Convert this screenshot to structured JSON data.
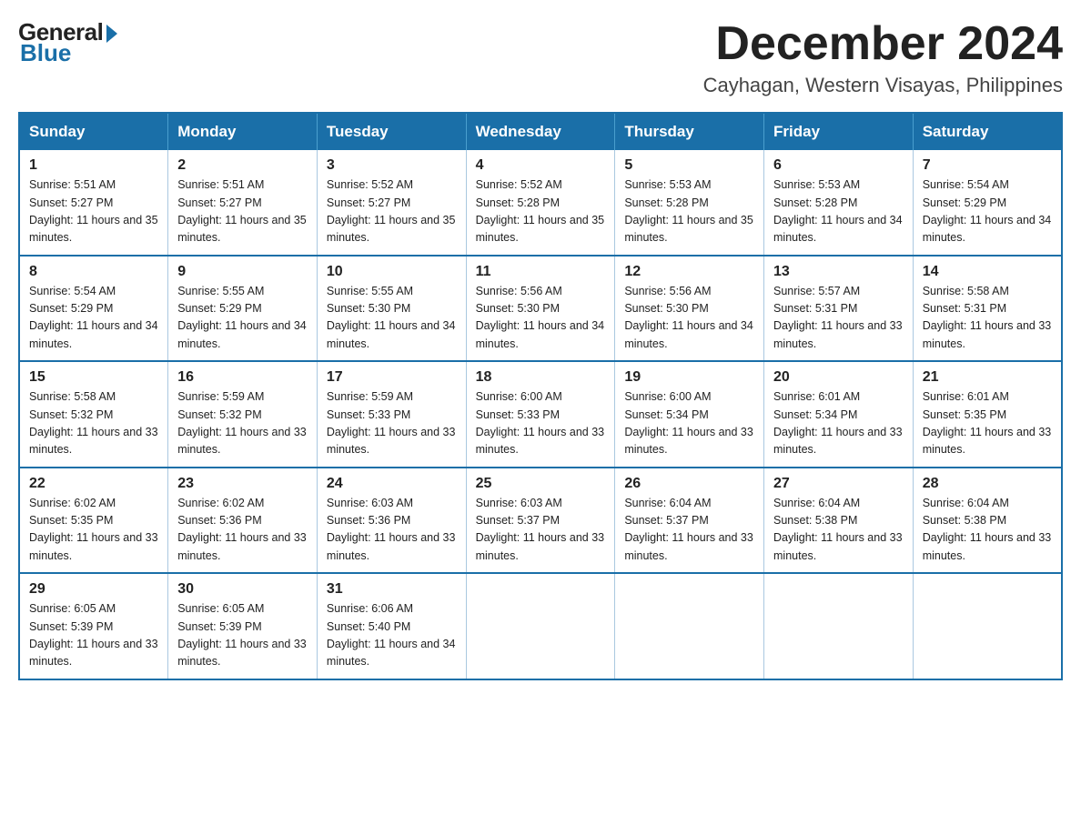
{
  "logo": {
    "general": "General",
    "blue": "Blue"
  },
  "header": {
    "month_year": "December 2024",
    "location": "Cayhagan, Western Visayas, Philippines"
  },
  "weekdays": [
    "Sunday",
    "Monday",
    "Tuesday",
    "Wednesday",
    "Thursday",
    "Friday",
    "Saturday"
  ],
  "weeks": [
    [
      {
        "day": "1",
        "sunrise": "5:51 AM",
        "sunset": "5:27 PM",
        "daylight": "11 hours and 35 minutes."
      },
      {
        "day": "2",
        "sunrise": "5:51 AM",
        "sunset": "5:27 PM",
        "daylight": "11 hours and 35 minutes."
      },
      {
        "day": "3",
        "sunrise": "5:52 AM",
        "sunset": "5:27 PM",
        "daylight": "11 hours and 35 minutes."
      },
      {
        "day": "4",
        "sunrise": "5:52 AM",
        "sunset": "5:28 PM",
        "daylight": "11 hours and 35 minutes."
      },
      {
        "day": "5",
        "sunrise": "5:53 AM",
        "sunset": "5:28 PM",
        "daylight": "11 hours and 35 minutes."
      },
      {
        "day": "6",
        "sunrise": "5:53 AM",
        "sunset": "5:28 PM",
        "daylight": "11 hours and 34 minutes."
      },
      {
        "day": "7",
        "sunrise": "5:54 AM",
        "sunset": "5:29 PM",
        "daylight": "11 hours and 34 minutes."
      }
    ],
    [
      {
        "day": "8",
        "sunrise": "5:54 AM",
        "sunset": "5:29 PM",
        "daylight": "11 hours and 34 minutes."
      },
      {
        "day": "9",
        "sunrise": "5:55 AM",
        "sunset": "5:29 PM",
        "daylight": "11 hours and 34 minutes."
      },
      {
        "day": "10",
        "sunrise": "5:55 AM",
        "sunset": "5:30 PM",
        "daylight": "11 hours and 34 minutes."
      },
      {
        "day": "11",
        "sunrise": "5:56 AM",
        "sunset": "5:30 PM",
        "daylight": "11 hours and 34 minutes."
      },
      {
        "day": "12",
        "sunrise": "5:56 AM",
        "sunset": "5:30 PM",
        "daylight": "11 hours and 34 minutes."
      },
      {
        "day": "13",
        "sunrise": "5:57 AM",
        "sunset": "5:31 PM",
        "daylight": "11 hours and 33 minutes."
      },
      {
        "day": "14",
        "sunrise": "5:58 AM",
        "sunset": "5:31 PM",
        "daylight": "11 hours and 33 minutes."
      }
    ],
    [
      {
        "day": "15",
        "sunrise": "5:58 AM",
        "sunset": "5:32 PM",
        "daylight": "11 hours and 33 minutes."
      },
      {
        "day": "16",
        "sunrise": "5:59 AM",
        "sunset": "5:32 PM",
        "daylight": "11 hours and 33 minutes."
      },
      {
        "day": "17",
        "sunrise": "5:59 AM",
        "sunset": "5:33 PM",
        "daylight": "11 hours and 33 minutes."
      },
      {
        "day": "18",
        "sunrise": "6:00 AM",
        "sunset": "5:33 PM",
        "daylight": "11 hours and 33 minutes."
      },
      {
        "day": "19",
        "sunrise": "6:00 AM",
        "sunset": "5:34 PM",
        "daylight": "11 hours and 33 minutes."
      },
      {
        "day": "20",
        "sunrise": "6:01 AM",
        "sunset": "5:34 PM",
        "daylight": "11 hours and 33 minutes."
      },
      {
        "day": "21",
        "sunrise": "6:01 AM",
        "sunset": "5:35 PM",
        "daylight": "11 hours and 33 minutes."
      }
    ],
    [
      {
        "day": "22",
        "sunrise": "6:02 AM",
        "sunset": "5:35 PM",
        "daylight": "11 hours and 33 minutes."
      },
      {
        "day": "23",
        "sunrise": "6:02 AM",
        "sunset": "5:36 PM",
        "daylight": "11 hours and 33 minutes."
      },
      {
        "day": "24",
        "sunrise": "6:03 AM",
        "sunset": "5:36 PM",
        "daylight": "11 hours and 33 minutes."
      },
      {
        "day": "25",
        "sunrise": "6:03 AM",
        "sunset": "5:37 PM",
        "daylight": "11 hours and 33 minutes."
      },
      {
        "day": "26",
        "sunrise": "6:04 AM",
        "sunset": "5:37 PM",
        "daylight": "11 hours and 33 minutes."
      },
      {
        "day": "27",
        "sunrise": "6:04 AM",
        "sunset": "5:38 PM",
        "daylight": "11 hours and 33 minutes."
      },
      {
        "day": "28",
        "sunrise": "6:04 AM",
        "sunset": "5:38 PM",
        "daylight": "11 hours and 33 minutes."
      }
    ],
    [
      {
        "day": "29",
        "sunrise": "6:05 AM",
        "sunset": "5:39 PM",
        "daylight": "11 hours and 33 minutes."
      },
      {
        "day": "30",
        "sunrise": "6:05 AM",
        "sunset": "5:39 PM",
        "daylight": "11 hours and 33 minutes."
      },
      {
        "day": "31",
        "sunrise": "6:06 AM",
        "sunset": "5:40 PM",
        "daylight": "11 hours and 34 minutes."
      },
      null,
      null,
      null,
      null
    ]
  ]
}
